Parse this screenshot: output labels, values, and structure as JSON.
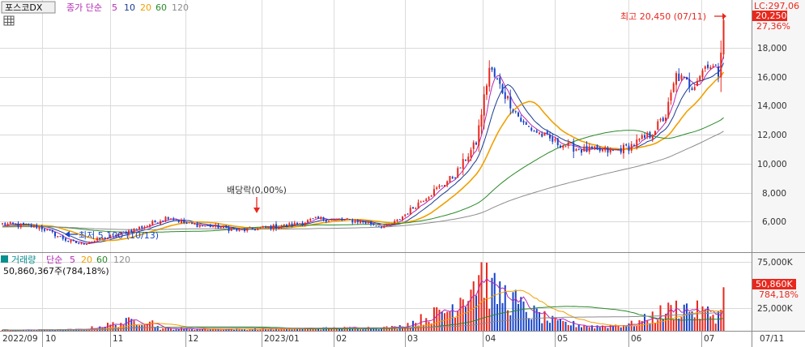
{
  "top_legend": {
    "symbol": "포스코DX",
    "mode": "종가 단순",
    "periods": [
      "5",
      "10",
      "20",
      "60",
      "120"
    ]
  },
  "volume_legend": {
    "label": "거래량",
    "mode": "단순",
    "periods": [
      "5",
      "20",
      "60",
      "120"
    ],
    "info": "50,860,367주(784,18%)"
  },
  "annotations": {
    "high": "최고 20,450 (07/11)",
    "low": "최저 5,100 (10/13)",
    "dividend": "배당락(0,00%)",
    "lc": "LC:297,06",
    "price_tag": "20,250",
    "price_pct": "27,36%",
    "vol_tag": "50,860K",
    "vol_pct": "784,18%"
  },
  "colors": {
    "up": "#e8281e",
    "down": "#1846c8",
    "ma5": "#b429b4",
    "ma10": "#1a3b8f",
    "ma20": "#f0a000",
    "ma60": "#2a8a2a",
    "ma120": "#8c8c8c",
    "vol_label": "#0a8f8f"
  },
  "chart_data": {
    "type": "candlestick",
    "price_axis": {
      "ticks": [
        "18,000",
        "16,000",
        "14,000",
        "12,000",
        "10,000",
        "8,000",
        "6,000"
      ],
      "range": [
        4600,
        21600
      ]
    },
    "volume_axis": {
      "ticks": [
        "75,000K",
        "25,000K"
      ],
      "range": [
        0,
        90000
      ]
    },
    "x_labels": [
      "2022/09",
      "10",
      "11",
      "12",
      "2023/01",
      "02",
      "03",
      "04",
      "05",
      "06",
      "07",
      "07/11"
    ],
    "series": [
      {
        "name": "5",
        "kind": "ma"
      },
      {
        "name": "10",
        "kind": "ma"
      },
      {
        "name": "20",
        "kind": "ma"
      },
      {
        "name": "60",
        "kind": "ma"
      },
      {
        "name": "120",
        "kind": "ma"
      }
    ],
    "anchors": [
      [
        0,
        6500
      ],
      [
        14,
        6300
      ],
      [
        25,
        5350
      ],
      [
        30,
        5150
      ],
      [
        40,
        5600
      ],
      [
        55,
        6400
      ],
      [
        63,
        7000
      ],
      [
        70,
        6500
      ],
      [
        82,
        6300
      ],
      [
        90,
        6050
      ],
      [
        110,
        6450
      ],
      [
        120,
        6850
      ],
      [
        135,
        6700
      ],
      [
        146,
        6300
      ],
      [
        150,
        6700
      ],
      [
        160,
        8200
      ],
      [
        172,
        9800
      ],
      [
        180,
        12000
      ],
      [
        185,
        17000
      ],
      [
        190,
        15500
      ],
      [
        198,
        13200
      ],
      [
        210,
        12000
      ],
      [
        220,
        11500
      ],
      [
        232,
        11400
      ],
      [
        238,
        11700
      ],
      [
        246,
        12500
      ],
      [
        252,
        13800
      ],
      [
        256,
        16500
      ],
      [
        262,
        15800
      ],
      [
        268,
        17400
      ],
      [
        272,
        16700
      ],
      [
        274,
        20250
      ]
    ],
    "volume_anchors": [
      [
        0,
        800
      ],
      [
        30,
        1500
      ],
      [
        55,
        14000
      ],
      [
        60,
        2500
      ],
      [
        90,
        1800
      ],
      [
        125,
        3000
      ],
      [
        150,
        4000
      ],
      [
        158,
        12000
      ],
      [
        170,
        25000
      ],
      [
        178,
        55000
      ],
      [
        182,
        70000
      ],
      [
        186,
        45000
      ],
      [
        192,
        40000
      ],
      [
        198,
        25000
      ],
      [
        210,
        10000
      ],
      [
        225,
        5000
      ],
      [
        240,
        8000
      ],
      [
        250,
        20000
      ],
      [
        258,
        28000
      ],
      [
        265,
        22000
      ],
      [
        272,
        18000
      ],
      [
        274,
        50860
      ]
    ]
  }
}
